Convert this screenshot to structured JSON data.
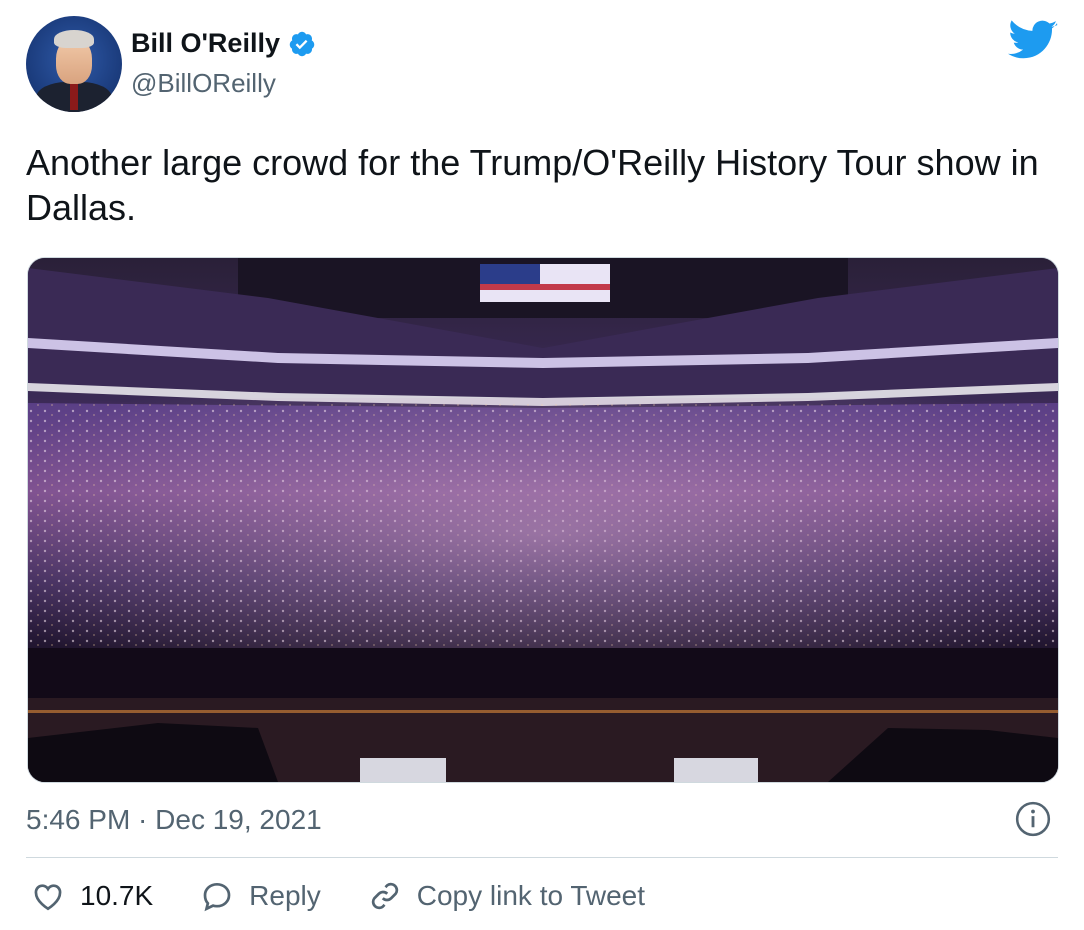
{
  "tweet": {
    "author": {
      "display_name": "Bill O'Reilly",
      "handle": "@BillOReilly",
      "verified": true
    },
    "text": "Another large crowd for the Trump/O'Reilly History Tour show in Dallas.",
    "media": {
      "description_icon": "photo"
    },
    "timestamp": "5:46 PM · Dec 19, 2021",
    "actions": {
      "likes": "10.7K",
      "reply_label": "Reply",
      "copy_link_label": "Copy link to Tweet"
    }
  },
  "colors": {
    "verified": "#1d9bf0",
    "twitter_blue": "#1d9bf0",
    "secondary_text": "#536471",
    "primary_text": "#0f1419"
  },
  "icons": [
    "verified-badge-icon",
    "twitter-bird-icon",
    "info-icon",
    "heart-icon",
    "reply-icon",
    "link-icon"
  ]
}
